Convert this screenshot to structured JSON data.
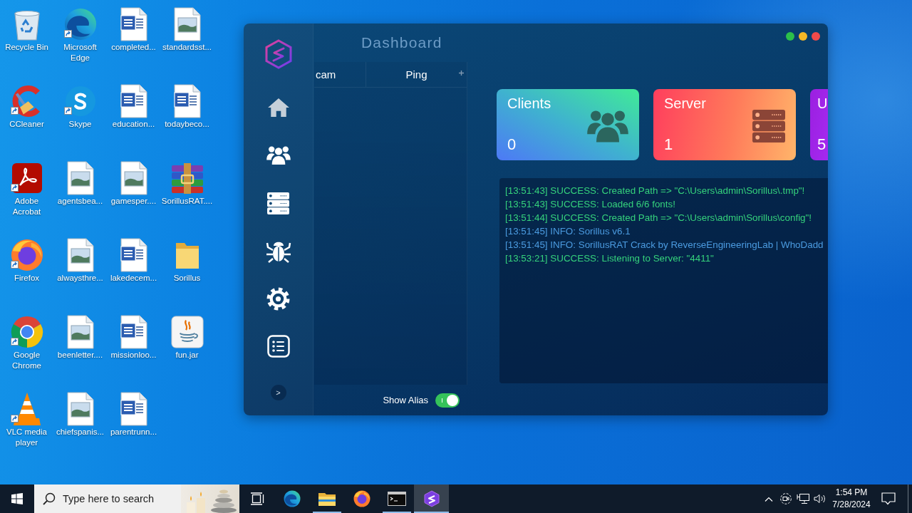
{
  "desktop": {
    "icons": [
      {
        "label": "Recycle Bin",
        "kind": "recycle-bin",
        "shortcut": false
      },
      {
        "label": "Microsoft Edge",
        "kind": "edge",
        "shortcut": true
      },
      {
        "label": "completed...",
        "kind": "word",
        "shortcut": false
      },
      {
        "label": "standardsst...",
        "kind": "image",
        "shortcut": false
      },
      {
        "label": "CCleaner",
        "kind": "ccleaner",
        "shortcut": true
      },
      {
        "label": "Skype",
        "kind": "skype",
        "shortcut": true
      },
      {
        "label": "education...",
        "kind": "word",
        "shortcut": false
      },
      {
        "label": "todaybeco...",
        "kind": "word",
        "shortcut": false
      },
      {
        "label": "Adobe Acrobat",
        "kind": "acrobat",
        "shortcut": true
      },
      {
        "label": "agentsbea...",
        "kind": "image",
        "shortcut": false
      },
      {
        "label": "gamesper....",
        "kind": "image",
        "shortcut": false
      },
      {
        "label": "SorillusRAT....",
        "kind": "archive",
        "shortcut": false
      },
      {
        "label": "Firefox",
        "kind": "firefox",
        "shortcut": true
      },
      {
        "label": "alwaysthre...",
        "kind": "image",
        "shortcut": false
      },
      {
        "label": "lakedecem...",
        "kind": "word",
        "shortcut": false
      },
      {
        "label": "Sorillus",
        "kind": "folder",
        "shortcut": false
      },
      {
        "label": "Google Chrome",
        "kind": "chrome",
        "shortcut": true
      },
      {
        "label": "beenletter....",
        "kind": "image",
        "shortcut": false
      },
      {
        "label": "missionloo...",
        "kind": "word",
        "shortcut": false
      },
      {
        "label": "fun.jar",
        "kind": "java",
        "shortcut": false
      },
      {
        "label": "VLC media player",
        "kind": "vlc",
        "shortcut": true
      },
      {
        "label": "chiefspanis...",
        "kind": "image",
        "shortcut": false
      },
      {
        "label": "parentrunn...",
        "kind": "word",
        "shortcut": false
      }
    ]
  },
  "window": {
    "title": "Dashboard",
    "controls": [
      {
        "color": "#2cc04a"
      },
      {
        "color": "#f5b827"
      },
      {
        "color": "#f04a4a"
      }
    ],
    "sidebar": {
      "items": [
        {
          "kind": "home",
          "selected": true
        },
        {
          "kind": "users",
          "selected": false
        },
        {
          "kind": "server",
          "selected": false
        },
        {
          "kind": "bug",
          "selected": false
        },
        {
          "kind": "gear",
          "selected": false
        },
        {
          "kind": "list",
          "selected": false
        }
      ],
      "expand_button": ">"
    },
    "table": {
      "columns": [
        "cam",
        "Ping"
      ]
    },
    "show_alias": {
      "label": "Show Alias",
      "on": true
    },
    "cards": [
      {
        "kind": "clients",
        "title": "Clients",
        "value": "0"
      },
      {
        "kind": "server",
        "title": "Server",
        "value": "1"
      },
      {
        "kind": "other",
        "title": "U",
        "value": "5"
      }
    ],
    "log": [
      {
        "kind": "success",
        "text": "[13:51:43] SUCCESS: Created Path => \"C:\\Users\\admin\\Sorillus\\.tmp\"!"
      },
      {
        "kind": "success",
        "text": "[13:51:43] SUCCESS: Loaded 6/6 fonts!"
      },
      {
        "kind": "success",
        "text": "[13:51:44] SUCCESS: Created Path => \"C:\\Users\\admin\\Sorillus\\config\"!"
      },
      {
        "kind": "info",
        "text": "[13:51:45] INFO: Sorillus v6.1"
      },
      {
        "kind": "info",
        "text": "[13:51:45] INFO: SorillusRAT Crack by ReverseEngineeringLab | WhoDadd"
      },
      {
        "kind": "success",
        "text": "[13:53:21] SUCCESS: Listening to Server: \"4411\""
      }
    ]
  },
  "taskbar": {
    "search": {
      "placeholder": "Type here to search"
    },
    "apps": [
      {
        "kind": "task-view",
        "running": false,
        "selected": false
      },
      {
        "kind": "edge",
        "running": false,
        "selected": false
      },
      {
        "kind": "explorer",
        "running": true,
        "selected": false
      },
      {
        "kind": "firefox",
        "running": false,
        "selected": false
      },
      {
        "kind": "terminal",
        "running": true,
        "selected": false
      },
      {
        "kind": "sorillus",
        "running": true,
        "selected": true
      }
    ],
    "clock": {
      "time": "1:54 PM",
      "date": "7/28/2024"
    }
  }
}
